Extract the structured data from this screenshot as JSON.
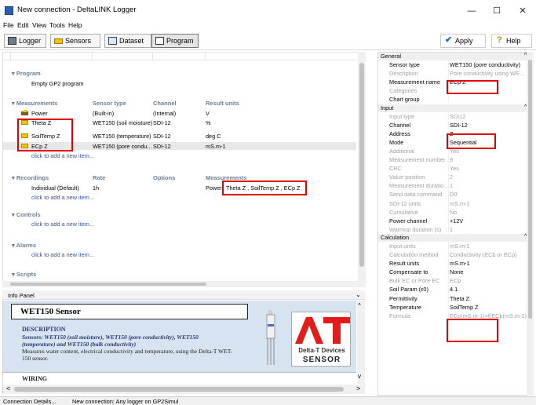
{
  "window": {
    "title": "New connection - DeltaLINK Logger",
    "min": "—",
    "max": "☐",
    "close": "✕"
  },
  "menu": [
    "File",
    "Edit",
    "View",
    "Tools",
    "Help"
  ],
  "toolbar": {
    "logger": "Logger",
    "sensors": "Sensors",
    "dataset": "Dataset",
    "program": "Program",
    "apply": "Apply",
    "help": "Help"
  },
  "program": {
    "section_program": "Program",
    "program_name": "Empty GP2 program",
    "section_measurements": "Measurements",
    "col_sensor_type": "Sensor type",
    "col_channel": "Channel",
    "col_result_units": "Result units",
    "measurements": [
      {
        "name": "Power",
        "type": "(Built-in)",
        "channel": "(Internal)",
        "units": "V"
      },
      {
        "name": "Theta Z",
        "type": "WET150 (soil moisture)",
        "channel": "SDI-12",
        "units": "%"
      },
      {
        "name": "SoilTemp Z",
        "type": "WET150 (temperature)",
        "channel": "SDI-12",
        "units": "deg C"
      },
      {
        "name": "ECp Z",
        "type": "WET150 (pore condu...",
        "channel": "SDI-12",
        "units": "mS.m-1"
      }
    ],
    "add_item": "click to add a new item...",
    "section_recordings": "Recordings",
    "col_rate": "Rate",
    "col_options": "Options",
    "col_measurements": "Measurements",
    "recording": {
      "name": "Individual (Default)",
      "rate": "1h",
      "measurements_prefix": "Power,",
      "measurements": "Theta Z , SoilTemp Z , ECp Z"
    },
    "section_controls": "Controls",
    "section_alarms": "Alarms",
    "section_scripts": "Scripts"
  },
  "info": {
    "header": "Info Panel",
    "sensor_title": "WET150 Sensor",
    "description_label": "DESCRIPTION",
    "desc_bold1": "Sensors: WET150 (soil moisture), WET150 (pore conductivity), WET150",
    "desc_bold2": "(temperature) and WET150 (bulk conductivity)",
    "desc_text1": "Measures water content, electrical conductivity and temperature, using the Delta-T WET-",
    "desc_text2": "150 sensor.",
    "wiring_label": "WIRING",
    "logo_company": "Delta-T Devices",
    "logo_sensor": "SENSOR"
  },
  "properties": {
    "groups": [
      {
        "name": "General",
        "rows": [
          {
            "label": "Sensor type",
            "value": "WET150 (pore conductivity)",
            "dim": false
          },
          {
            "label": "Description",
            "value": "Pore conductivity using WE...",
            "dim": true
          },
          {
            "label": "Measurement name",
            "value": "ECp Z",
            "dim": false
          },
          {
            "label": "Categories",
            "value": "",
            "dim": true
          },
          {
            "label": "Chart group",
            "value": "",
            "dim": false
          }
        ]
      },
      {
        "name": "Input",
        "rows": [
          {
            "label": "Input type",
            "value": "SDI12",
            "dim": true
          },
          {
            "label": "Channel",
            "value": "SDI-12",
            "dim": false
          },
          {
            "label": "Address",
            "value": "Z",
            "dim": false
          },
          {
            "label": "Mode",
            "value": "Sequential",
            "dim": false
          },
          {
            "label": "Additional",
            "value": "Yes",
            "dim": true
          },
          {
            "label": "Measurement number",
            "value": "9",
            "dim": true
          },
          {
            "label": "CRC",
            "value": "Yes",
            "dim": true
          },
          {
            "label": "Value position",
            "value": "2",
            "dim": true
          },
          {
            "label": "Measurement duratio...",
            "value": "1",
            "dim": true
          },
          {
            "label": "Send data command",
            "value": "D0",
            "dim": true
          },
          {
            "label": "SDI-12 units",
            "value": "mS.m-1",
            "dim": true
          },
          {
            "label": "Cumulative",
            "value": "No",
            "dim": true
          },
          {
            "label": "Power channel",
            "value": "+12V",
            "dim": false
          },
          {
            "label": "Warmup duration (s)",
            "value": "1",
            "dim": true
          }
        ]
      },
      {
        "name": "Calculation",
        "rows": [
          {
            "label": "Input units",
            "value": "mS.m-1",
            "dim": true
          },
          {
            "label": "Calculation method",
            "value": "Conductivity (ECb or ECp)",
            "dim": true
          },
          {
            "label": "Result units",
            "value": "mS.m-1",
            "dim": false
          },
          {
            "label": "Compensate to",
            "value": "None",
            "dim": false
          },
          {
            "label": "Bulk EC or Pore EC",
            "value": "ECp",
            "dim": true
          },
          {
            "label": "Soil Param (ε0)",
            "value": "4.1",
            "dim": false
          },
          {
            "label": "Permittivity",
            "value": "Theta Z",
            "dim": false
          },
          {
            "label": "Temperature",
            "value": "SoilTemp Z",
            "dim": false
          },
          {
            "label": "Formula",
            "value": "ECp(mS.m-1)=f(ECb(mS.m-1)",
            "dim": true
          }
        ]
      }
    ]
  },
  "status": {
    "left": "Connection Details...",
    "right": "New connection: Any logger on GP2Simul"
  }
}
